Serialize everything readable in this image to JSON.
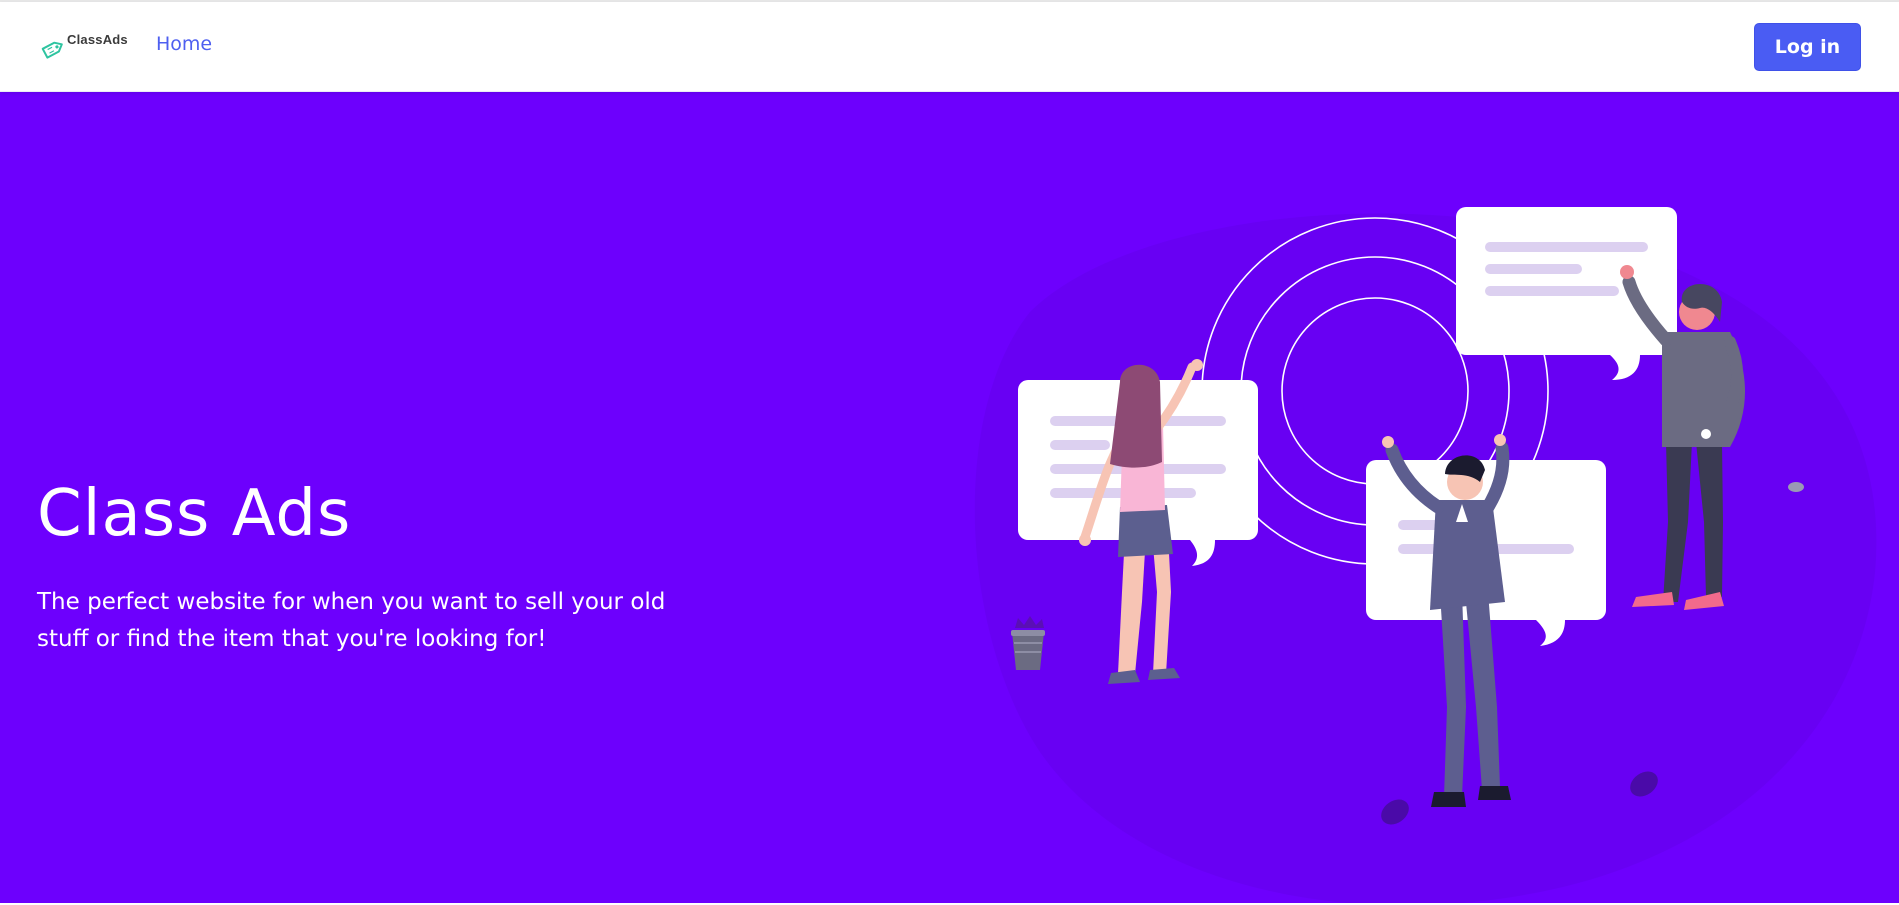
{
  "navbar": {
    "brand_name": "ClassAds",
    "logo_icon": "price-tag-icon",
    "home_link": "Home",
    "login_button": "Log in"
  },
  "hero": {
    "title": "Class Ads",
    "subtitle": "The perfect website for when you want to sell your old stuff or find the item that you're looking for!",
    "illustration": "people-posting-ads-illustration"
  },
  "colors": {
    "hero_background": "#6d00fd",
    "accent": "#4a5cf3",
    "nav_link": "#4e5ff0",
    "logo_tag": "#2ec4a0"
  }
}
